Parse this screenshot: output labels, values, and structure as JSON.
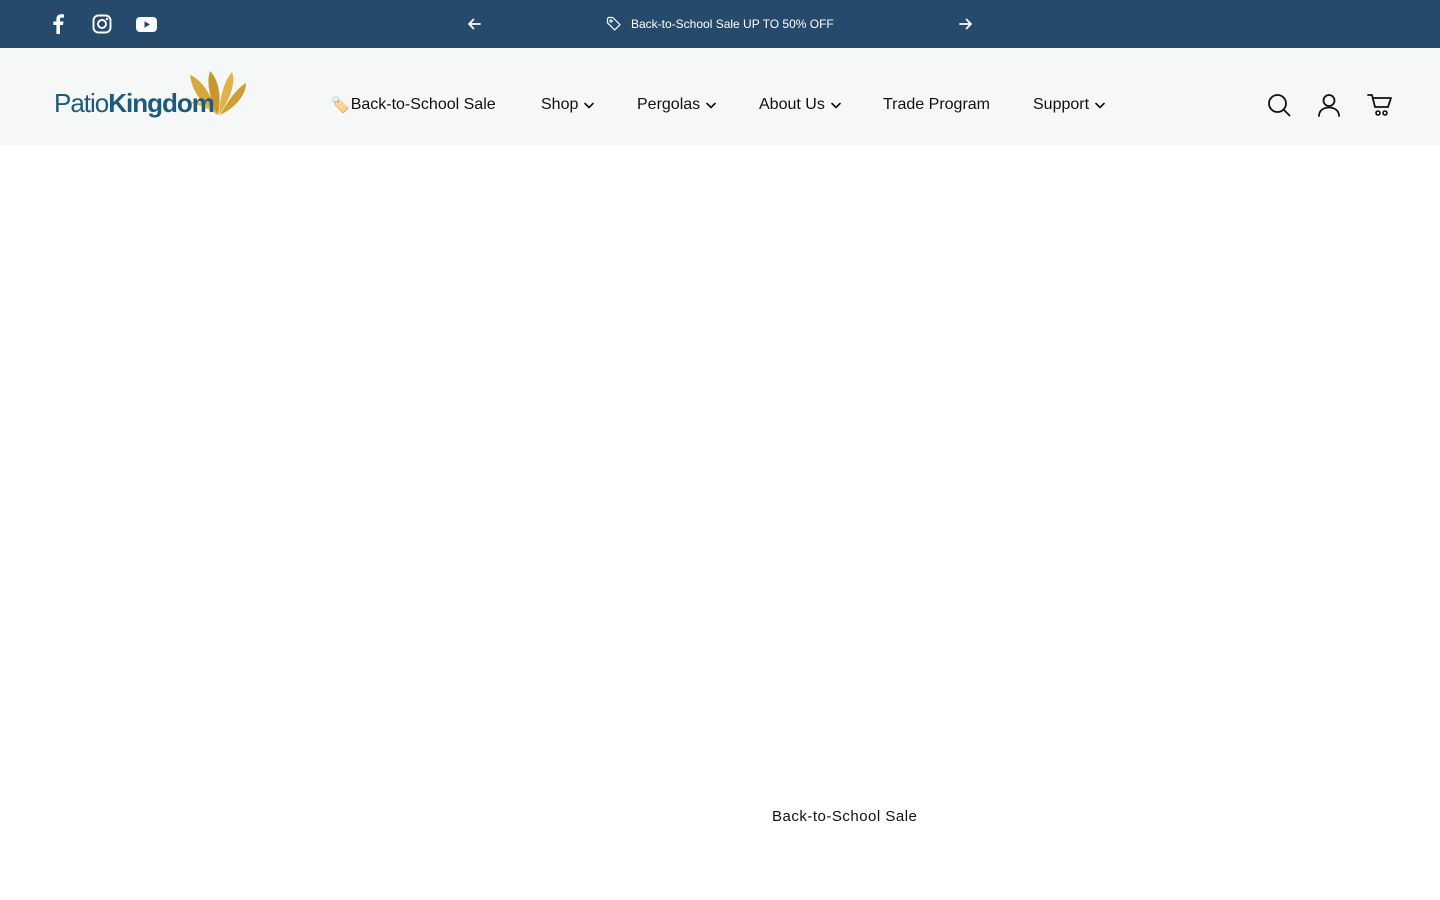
{
  "topbar": {
    "background": "#264a6b",
    "social": [
      {
        "icon": "facebook-icon"
      },
      {
        "icon": "instagram-icon"
      },
      {
        "icon": "youtube-icon"
      }
    ],
    "announcement": "Back-to-School Sale UP TO 50% OFF",
    "prev_icon": "arrow-left-icon",
    "next_icon": "arrow-right-icon"
  },
  "header": {
    "logo": {
      "word1": "Patio",
      "word2": "Kingdom",
      "brand_blue": "#1d5a7d",
      "brand_gold": "#d7a73a"
    },
    "nav": [
      {
        "label": "Back-to-School Sale",
        "emoji": "🏷️",
        "dropdown": false
      },
      {
        "label": "Shop",
        "dropdown": true
      },
      {
        "label": "Pergolas",
        "dropdown": true
      },
      {
        "label": "About Us",
        "dropdown": true
      },
      {
        "label": "Trade Program",
        "dropdown": false
      },
      {
        "label": "Support",
        "dropdown": true
      }
    ],
    "icons": [
      "search-icon",
      "account-icon",
      "cart-icon"
    ]
  },
  "hero": {
    "caption": "Back-to-School Sale"
  }
}
